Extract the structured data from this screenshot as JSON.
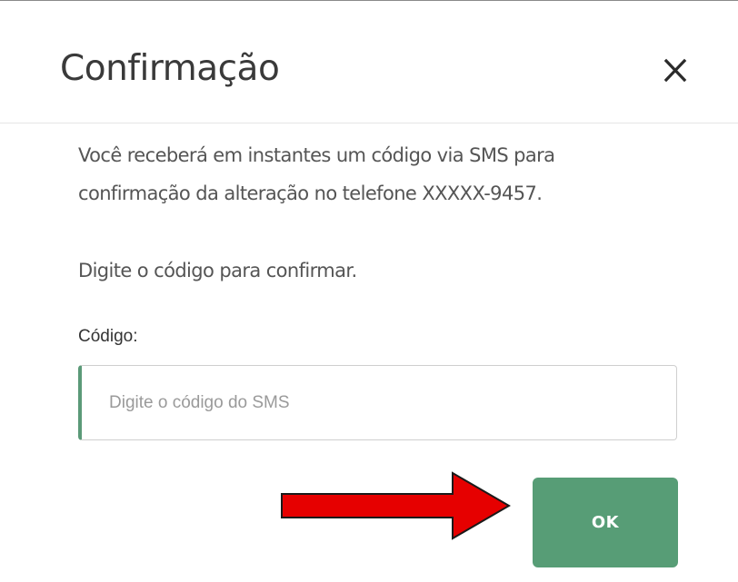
{
  "dialog": {
    "title": "Confirmação",
    "close_icon": "close-icon",
    "message_line1": "Você receberá em instantes um código via SMS para",
    "message_line2": "confirmação da alteração no telefone XXXXX-9457.",
    "instruction": "Digite o código para confirmar.",
    "code_field": {
      "label": "Código:",
      "placeholder": "Digite o código do SMS",
      "value": ""
    },
    "ok_label": "OK"
  },
  "annotation": {
    "arrow_icon": "red-arrow-right-icon",
    "arrow_color": "#e60000"
  },
  "colors": {
    "accent": "#579d76",
    "title_text": "#3a3a3a",
    "body_text": "#555555"
  }
}
